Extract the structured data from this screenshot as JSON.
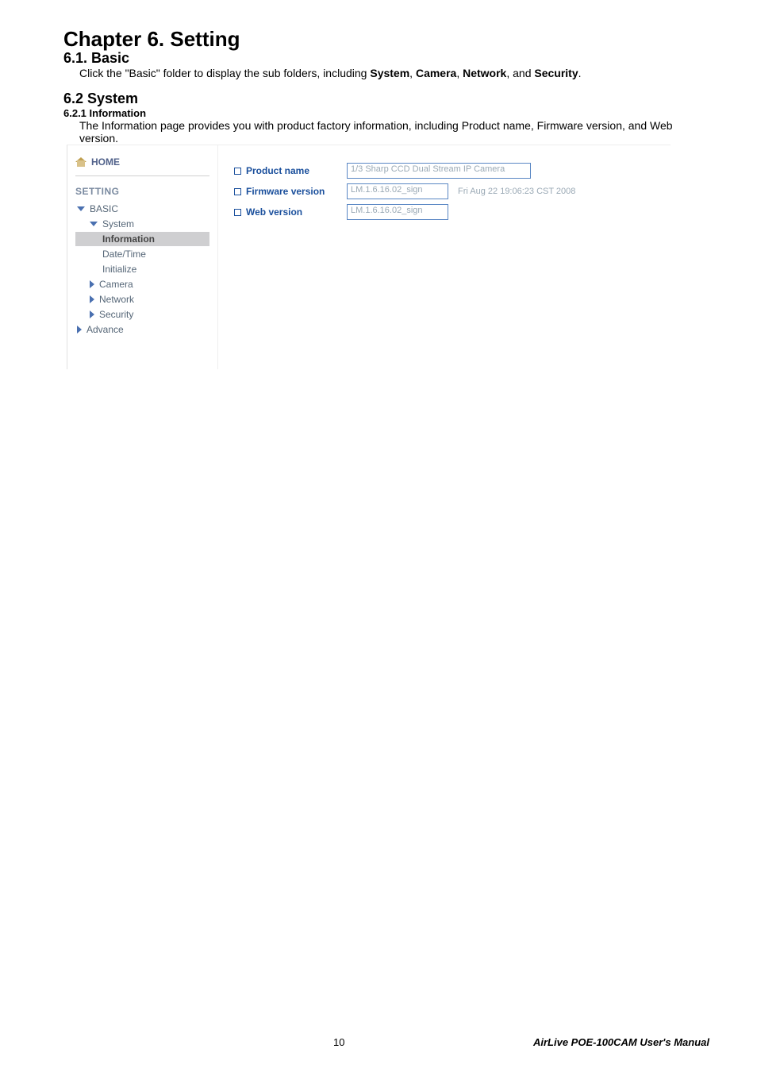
{
  "doc": {
    "chapter_title": "Chapter 6. Setting",
    "section_6_1": "6.1. Basic",
    "section_6_1_body_pre": "Click the \"Basic\" folder to display the sub folders, including ",
    "section_6_1_bold1": "System",
    "section_6_1_bold2": "Camera",
    "section_6_1_bold3": "Network",
    "section_6_1_and": ", and ",
    "section_6_1_bold4": "Security",
    "section_6_1_end": ".",
    "section_6_2": "6.2 System",
    "section_6_2_1": "6.2.1 Information",
    "section_6_2_1_body": "The Information page provides you with product factory information, including Product name, Firmware version, and Web version.",
    "comma": ", "
  },
  "ui": {
    "home": "HOME",
    "setting": "SETTING",
    "basic": "BASIC",
    "system": "System",
    "information": "Information",
    "date_time": "Date/Time",
    "initialize": "Initialize",
    "camera": "Camera",
    "network": "Network",
    "security": "Security",
    "advance": "Advance",
    "product_name_label": "Product name",
    "product_name_value": "1/3 Sharp CCD Dual Stream IP Camera",
    "firmware_label": "Firmware version",
    "firmware_value": "LM.1.6.16.02_sign",
    "firmware_date": "Fri Aug 22 19:06:23 CST 2008",
    "web_label": "Web version",
    "web_value": "LM.1.6.16.02_sign"
  },
  "footer": {
    "page": "10",
    "manual": "AirLive POE-100CAM  User's  Manual"
  }
}
